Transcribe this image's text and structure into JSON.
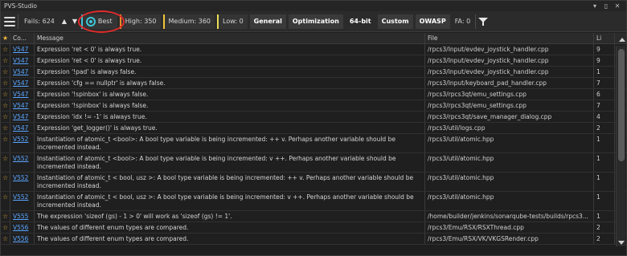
{
  "window": {
    "title": "PVS-Studio",
    "buttons": {
      "minimize": "▾",
      "pin": "▯",
      "close": "✕"
    }
  },
  "toolbar": {
    "fails_label": "Fails: 624",
    "best_label": "Best",
    "high_label": "High: 350",
    "medium_label": "Medium: 360",
    "low_label": "Low: 0",
    "general_label": "General",
    "optimization_label": "Optimization",
    "bit64_label": "64-bit",
    "custom_label": "Custom",
    "owasp_label": "OWASP",
    "fa_label": "FA: 0"
  },
  "colors": {
    "best": "#3cc6d8",
    "high": "#f08a24",
    "medium": "#f2c43a",
    "low": "#e9de57",
    "highlight_ring": "#e12b2b",
    "link": "#5aa6ff"
  },
  "table": {
    "headers": {
      "star": "★",
      "code": "Co...",
      "message": "Message",
      "file": "File",
      "line": "Li"
    },
    "rows": [
      {
        "code": "V547",
        "message": "Expression 'ret < 0' is always true.",
        "file": "/rpcs3/Input/evdev_joystick_handler.cpp",
        "line": "9"
      },
      {
        "code": "V547",
        "message": "Expression 'ret < 0' is always true.",
        "file": "/rpcs3/Input/evdev_joystick_handler.cpp",
        "line": "9"
      },
      {
        "code": "V547",
        "message": "Expression '!pad' is always false.",
        "file": "/rpcs3/Input/evdev_joystick_handler.cpp",
        "line": "1"
      },
      {
        "code": "V547",
        "message": "Expression 'cfg == nullptr' is always false.",
        "file": "/rpcs3/Input/keyboard_pad_handler.cpp",
        "line": "7"
      },
      {
        "code": "V547",
        "message": "Expression '!spinbox' is always false.",
        "file": "/rpcs3/rpcs3qt/emu_settings.cpp",
        "line": "6"
      },
      {
        "code": "V547",
        "message": "Expression '!spinbox' is always false.",
        "file": "/rpcs3/rpcs3qt/emu_settings.cpp",
        "line": "7"
      },
      {
        "code": "V547",
        "message": "Expression 'idx != -1' is always true.",
        "file": "/rpcs3/rpcs3qt/save_manager_dialog.cpp",
        "line": "4"
      },
      {
        "code": "V547",
        "message": "Expression 'get_logger()' is always true.",
        "file": "/rpcs3/util/logs.cpp",
        "line": "2"
      },
      {
        "code": "V552",
        "message": "Instantiation of atomic_t <bool>: A bool type variable is being incremented: ++ v. Perhaps another variable should be incremented instead.",
        "file": "/rpcs3/util/atomic.hpp",
        "line": "1"
      },
      {
        "code": "V552",
        "message": "Instantiation of atomic_t <bool>: A bool type variable is being incremented: v ++. Perhaps another variable should be incremented instead.",
        "file": "/rpcs3/util/atomic.hpp",
        "line": "1"
      },
      {
        "code": "V552",
        "message": "Instantiation of atomic_t < bool, usz >: A bool type variable is being incremented: ++ v. Perhaps another variable should be incremented instead.",
        "file": "/rpcs3/util/atomic.hpp",
        "line": "1"
      },
      {
        "code": "V552",
        "message": "Instantiation of atomic_t < bool, usz >: A bool type variable is being incremented: v ++. Perhaps another variable should be incremented instead.",
        "file": "/rpcs3/util/atomic.hpp",
        "line": "1"
      },
      {
        "code": "V555",
        "message": "The expression 'sizeof (gs) - 1 > 0' will work as 'sizeof (gs) != 1'.",
        "file": "/home/builder/jenkins/sonarqube-tests/builds/rpcs3...",
        "line": "1"
      },
      {
        "code": "V556",
        "message": "The values of different enum types are compared.",
        "file": "/rpcs3/Emu/RSX/RSXThread.cpp",
        "line": "2"
      },
      {
        "code": "V556",
        "message": "The values of different enum types are compared.",
        "file": "/rpcs3/Emu/RSX/VK/VKGSRender.cpp",
        "line": "2"
      }
    ]
  }
}
